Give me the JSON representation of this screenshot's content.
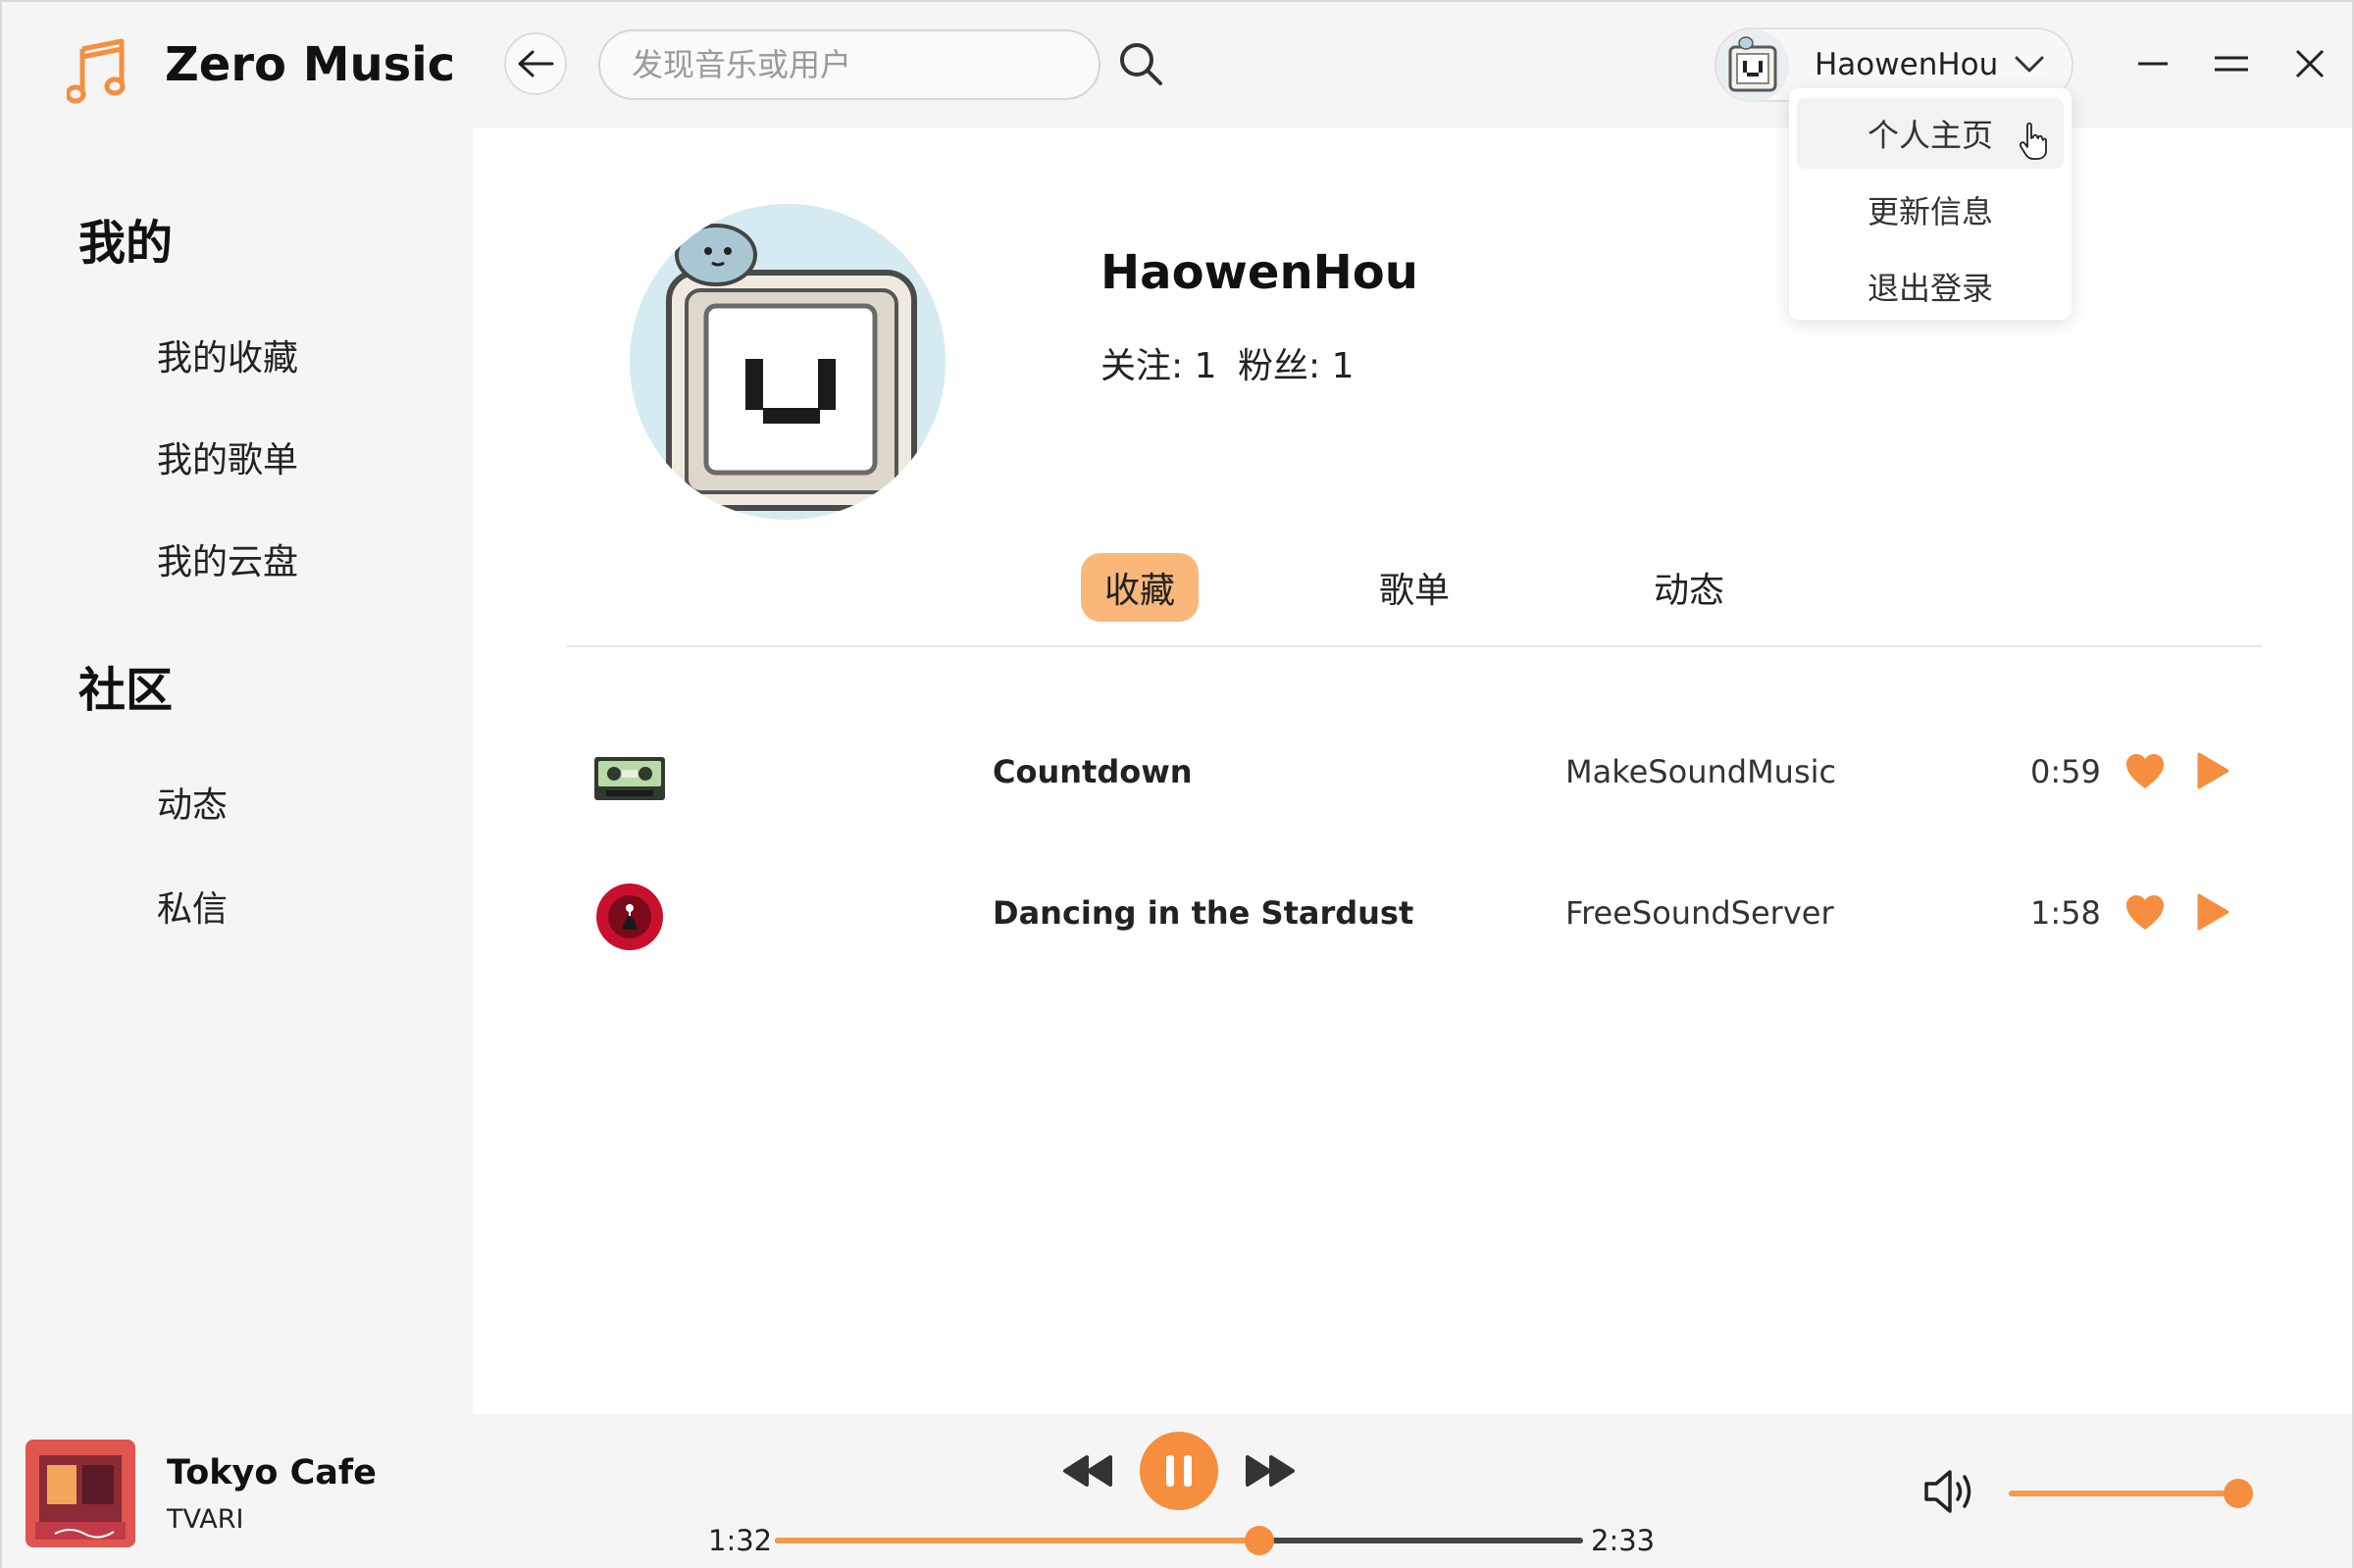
{
  "app": {
    "title": "Zero Music",
    "accent_color": "#f58e3e",
    "accent_light": "#fbb67a"
  },
  "header": {
    "back_icon": "arrow-left-icon",
    "search_placeholder": "发现音乐或用户",
    "search_icon": "search-icon",
    "user_name": "HaowenHou",
    "user_menu_icon": "chevron-down-icon",
    "window_controls": [
      "minimize-icon",
      "maximize-icon",
      "close-icon"
    ]
  },
  "user_menu": {
    "items": [
      "个人主页",
      "更新信息",
      "退出登录"
    ],
    "hovered": "个人主页"
  },
  "sidebar": {
    "sections": [
      {
        "heading": "我的",
        "items": [
          "我的收藏",
          "我的歌单",
          "我的云盘"
        ]
      },
      {
        "heading": "社区",
        "items": [
          "动态",
          "私信"
        ]
      }
    ]
  },
  "profile": {
    "name": "HaowenHou",
    "following_label": "关注: 1",
    "followers_label": "粉丝: 1",
    "tabs": [
      "收藏",
      "歌单",
      "动态"
    ],
    "active_tab": "收藏"
  },
  "songs": [
    {
      "title": "Countdown",
      "artist": "MakeSoundMusic",
      "duration": "0:59",
      "cover": "cassette-cover"
    },
    {
      "title": "Dancing in the Stardust",
      "artist": "FreeSoundServer",
      "duration": "1:58",
      "cover": "red-disc-cover"
    }
  ],
  "player": {
    "title": "Tokyo Cafe",
    "artist": "TVARI",
    "current_time": "1:32",
    "total_time": "2:33",
    "progress": 0.6,
    "volume": 0.96,
    "state": "playing"
  }
}
